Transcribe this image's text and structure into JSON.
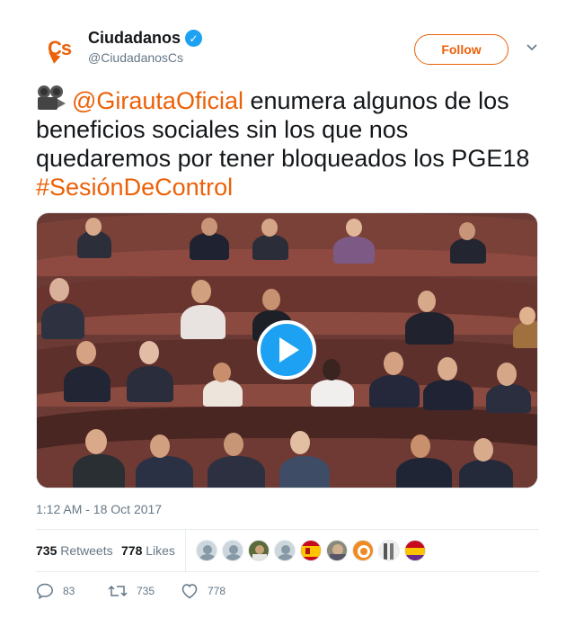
{
  "account": {
    "display_name": "Ciudadanos",
    "handle": "@CiudadanosCs",
    "verified": true,
    "avatar_text": "Cs",
    "brand_color": "#eb6109"
  },
  "header": {
    "follow_label": "Follow",
    "caret_icon": "chevron-down-icon"
  },
  "tweet": {
    "emoji": "movie-camera-icon",
    "mention": "@GirautaOficial",
    "text_main": " enumera algunos de los beneficios sociales sin los que nos quedaremos por tener bloqueados los PGE18 ",
    "hashtag": "#SesiónDeControl",
    "link_color": "#eb6109"
  },
  "media": {
    "type": "video",
    "play_icon": "play-icon",
    "play_color": "#1da1f2"
  },
  "timestamp": "1:12 AM - 18 Oct 2017",
  "stats": {
    "retweets_count": "735",
    "retweets_label": "Retweets",
    "likes_count": "778",
    "likes_label": "Likes",
    "liker_avatars": [
      "default",
      "default",
      "photo",
      "default",
      "spain-flag",
      "photo",
      "orange",
      "photo",
      "flag"
    ]
  },
  "actions": {
    "reply_count": "83",
    "retweet_count": "735",
    "like_count": "778"
  }
}
